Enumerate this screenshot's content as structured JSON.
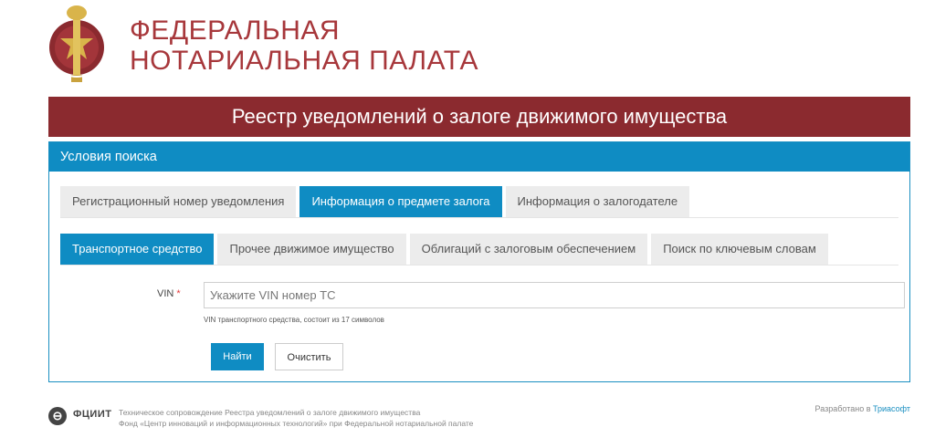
{
  "org": {
    "line1": "ФЕДЕРАЛЬНАЯ",
    "line2": "НОТАРИАЛЬНАЯ ПАЛАТА"
  },
  "banner": {
    "title": "Реестр уведомлений о залоге движимого имущества"
  },
  "panel": {
    "title": "Условия поиска"
  },
  "tabs_primary": [
    {
      "label": "Регистрационный номер уведомления",
      "active": false
    },
    {
      "label": "Информация о предмете залога",
      "active": true
    },
    {
      "label": "Информация о залогодателе",
      "active": false
    }
  ],
  "tabs_secondary": [
    {
      "label": "Транспортное средство",
      "active": true
    },
    {
      "label": "Прочее движимое имущество",
      "active": false
    },
    {
      "label": "Облигаций с залоговым обеспечением",
      "active": false
    },
    {
      "label": "Поиск по ключевым словам",
      "active": false
    }
  ],
  "vin": {
    "label": "VIN",
    "required_mark": "*",
    "value": "",
    "placeholder": "Укажите VIN номер ТС",
    "hint": "VIN транспортного средства, состоит из 17 символов"
  },
  "buttons": {
    "find": "Найти",
    "clear": "Очистить"
  },
  "footer": {
    "logo_text": "ФЦИИТ",
    "line1": "Техническое сопровождение Реестра уведомлений о залоге движимого имущества",
    "line2": "Фонд «Центр инноваций и информационных технологий» при Федеральной нотариальной палате",
    "dev_prefix": "Разработано в",
    "dev_link": "Триасофт"
  },
  "colors": {
    "brand_red": "#8b2a2f",
    "brand_blue": "#0f8cc3",
    "title_red": "#a7373b"
  },
  "icons": {
    "logo": "notary-emblem-icon",
    "fciit": "fciit-logo-icon"
  }
}
